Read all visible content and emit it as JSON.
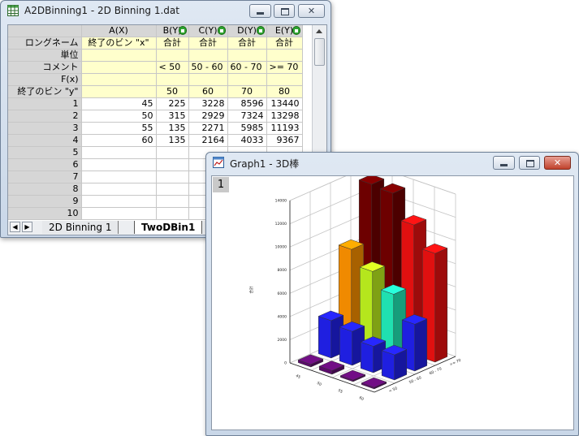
{
  "worksheet": {
    "title": "A2DBinning1 - 2D Binning 1.dat",
    "columns": [
      "A(X)",
      "B(Y)",
      "C(Y)",
      "D(Y)",
      "E(Y)"
    ],
    "meta_rows": [
      {
        "label": "ロングネーム",
        "cells": [
          "終了のビン \"x\"",
          "合計",
          "合計",
          "合計",
          "合計"
        ]
      },
      {
        "label": "単位",
        "cells": [
          "",
          "",
          "",
          "",
          ""
        ]
      },
      {
        "label": "コメント",
        "cells": [
          "",
          "< 50",
          "50 - 60",
          "60 - 70",
          ">= 70"
        ]
      },
      {
        "label": "F(x)",
        "cells": [
          "",
          "",
          "",
          "",
          ""
        ]
      },
      {
        "label": "終了のビン \"y\"",
        "cells": [
          "",
          "50",
          "60",
          "70",
          "80"
        ]
      }
    ],
    "data_rows": [
      {
        "row": "1",
        "cells": [
          "45",
          "225",
          "3228",
          "8596",
          "13440"
        ]
      },
      {
        "row": "2",
        "cells": [
          "50",
          "315",
          "2929",
          "7324",
          "13298"
        ]
      },
      {
        "row": "3",
        "cells": [
          "55",
          "135",
          "2271",
          "5985",
          "11193"
        ]
      },
      {
        "row": "4",
        "cells": [
          "60",
          "135",
          "2164",
          "4033",
          "9367"
        ]
      },
      {
        "row": "5",
        "cells": [
          "",
          "",
          "",
          "",
          ""
        ]
      },
      {
        "row": "6",
        "cells": [
          "",
          "",
          "",
          "",
          ""
        ]
      },
      {
        "row": "7",
        "cells": [
          "",
          "",
          "",
          "",
          ""
        ]
      },
      {
        "row": "8",
        "cells": [
          "",
          "",
          "",
          "",
          ""
        ]
      },
      {
        "row": "9",
        "cells": [
          "",
          "",
          "",
          "",
          ""
        ]
      },
      {
        "row": "10",
        "cells": [
          "",
          "",
          "",
          "",
          ""
        ]
      }
    ],
    "tabs": [
      "2D Binning 1",
      "TwoDBin1"
    ],
    "active_tab": 1,
    "icons": {
      "window": "worksheet-icon",
      "lock": "lock-icon"
    }
  },
  "graph": {
    "title": "Graph1 - 3D棒",
    "layer_label": "1",
    "icons": {
      "window": "graph-icon"
    }
  },
  "chart_data": {
    "type": "bar",
    "subtype": "3d-bar",
    "ylabel": "合計",
    "x_categories": [
      "45",
      "50",
      "55",
      "60"
    ],
    "y_categories": [
      "< 50",
      "50 - 60",
      "60 - 70",
      ">= 70"
    ],
    "z_ticks": [
      "0",
      "2000",
      "4000",
      "6000",
      "8000",
      "10000",
      "12000",
      "14000"
    ],
    "zlim": [
      0,
      14000
    ],
    "series": [
      {
        "name": "< 50",
        "values": [
          225,
          315,
          135,
          135
        ],
        "color": "#5b0b6b"
      },
      {
        "name": "50 - 60",
        "values": [
          3228,
          2929,
          2271,
          2164
        ],
        "color": "#1f1fe0"
      },
      {
        "name": "60 - 70",
        "values": [
          8596,
          7324,
          5985,
          4033
        ],
        "colors": [
          "#f08a00",
          "#b5e61d",
          "#20e0b0",
          "#1f1fe0"
        ]
      },
      {
        "name": ">= 70",
        "values": [
          13440,
          13298,
          11193,
          9367
        ],
        "colors": [
          "#6d0000",
          "#6d0000",
          "#e01010",
          "#e01010"
        ]
      }
    ],
    "grid": true
  }
}
